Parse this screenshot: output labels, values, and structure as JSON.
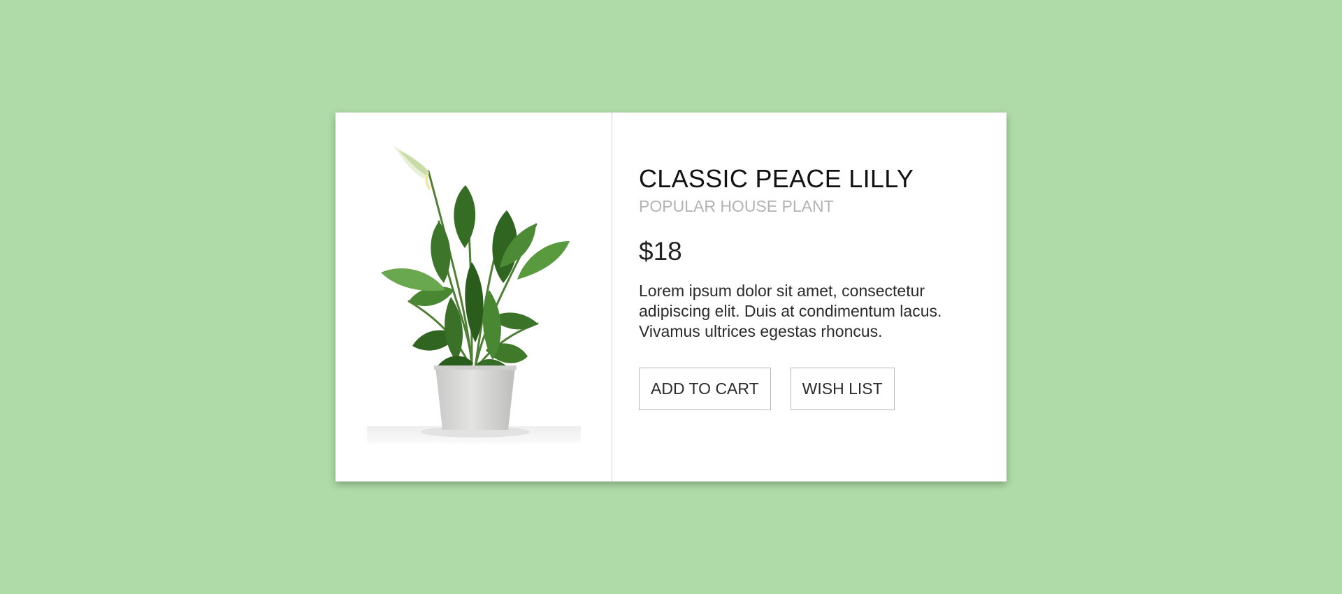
{
  "colors": {
    "background": "#afdba8",
    "card": "#ffffff",
    "title": "#111111",
    "subtitle": "#b3b3b3",
    "leaf_dark": "#2f5e22",
    "leaf_light": "#6aa84f",
    "pot": "#d7d8d6"
  },
  "product": {
    "image_icon": "potted-plant-image",
    "title": "CLASSIC PEACE LILLY",
    "subtitle": "POPULAR HOUSE PLANT",
    "price": "$18",
    "description": "Lorem ipsum dolor sit amet, consectetur adipiscing elit. Duis at condimentum lacus. Vivamus ultrices egestas rhoncus."
  },
  "actions": {
    "add_to_cart_label": "ADD TO CART",
    "wish_list_label": "WISH LIST"
  }
}
